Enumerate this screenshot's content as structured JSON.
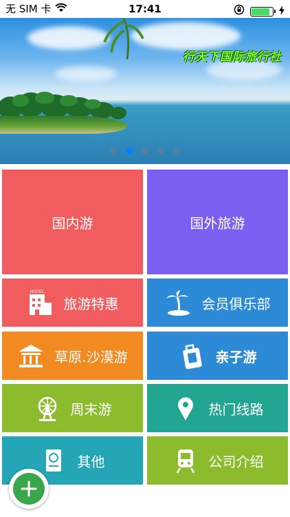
{
  "status_bar": {
    "carrier": "无 SIM 卡",
    "time": "17:41"
  },
  "banner": {
    "title": "行天下国际旅行社",
    "page_count": 5,
    "active_page": 2
  },
  "tiles": [
    {
      "label": "国内游",
      "color": "#f15c5e",
      "icon": "none"
    },
    {
      "label": "国外旅游",
      "color": "#7b5ff0",
      "icon": "none"
    },
    {
      "label": "旅游特惠",
      "color": "#f15c5e",
      "icon": "hotel-icon"
    },
    {
      "label": "会员俱乐部",
      "color": "#2d8ad6",
      "icon": "palm-island-icon"
    },
    {
      "label": "草原.沙漠游",
      "color": "#f28a22",
      "icon": "pavilion-icon"
    },
    {
      "label": "亲子游",
      "color": "#2d8ad6",
      "icon": "luggage-icon"
    },
    {
      "label": "周末游",
      "color": "#8cbb2e",
      "icon": "ferris-wheel-icon"
    },
    {
      "label": "热门线路",
      "color": "#23a593",
      "icon": "pin-icon"
    },
    {
      "label": "其他",
      "color": "#24a6b6",
      "icon": "passport-icon"
    },
    {
      "label": "公司介绍",
      "color": "#8cbb2e",
      "icon": "train-icon"
    }
  ],
  "fab": {
    "icon": "plus-icon",
    "color": "#3aa64a"
  }
}
